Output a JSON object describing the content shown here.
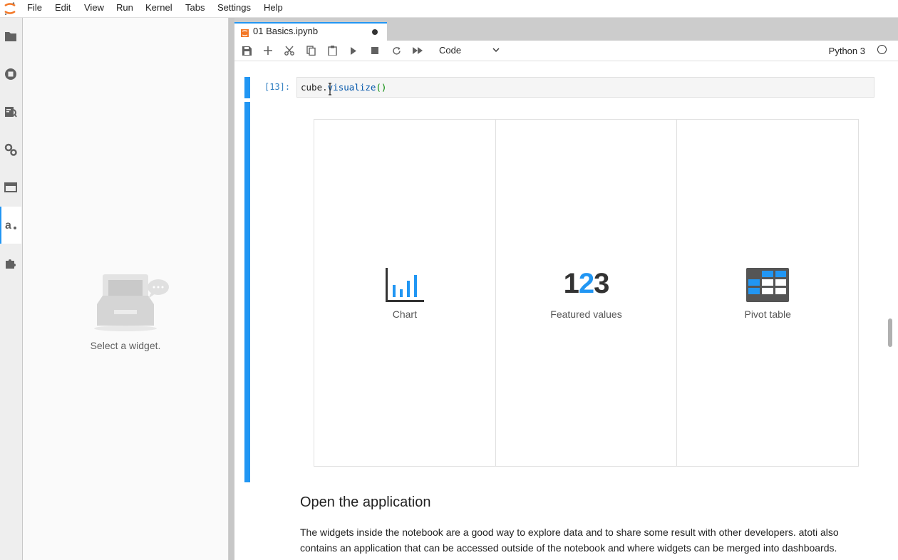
{
  "menubar": {
    "items": [
      "File",
      "Edit",
      "View",
      "Run",
      "Kernel",
      "Tabs",
      "Settings",
      "Help"
    ]
  },
  "activitybar": {
    "icons": [
      "folder-icon",
      "running-icon",
      "property-inspector-icon",
      "settings-icon",
      "tabs-icon",
      "atoti-icon",
      "extensions-icon"
    ]
  },
  "leftpanel": {
    "empty_text": "Select a widget."
  },
  "tab": {
    "title": "01 Basics.ipynb"
  },
  "toolbar": {
    "cell_type": "Code",
    "kernel": "Python 3"
  },
  "cell": {
    "prompt": "[13]:",
    "code_var": "cube",
    "code_dot": ".",
    "code_fn": "visualize",
    "code_parens": "()"
  },
  "widget": {
    "options": [
      {
        "label": "Chart"
      },
      {
        "label": "Featured values",
        "number_1": "1",
        "number_2": "2",
        "number_3": "3"
      },
      {
        "label": "Pivot table"
      }
    ]
  },
  "markdown": {
    "heading": "Open the application",
    "paragraph": "The widgets inside the notebook are a good way to explore data and to share some result with other developers. atoti also contains an application that can be accessed outside of the notebook and where widgets can be merged into dashboards."
  },
  "colors": {
    "accent": "#2196f3",
    "logo_orange": "#f37726"
  }
}
